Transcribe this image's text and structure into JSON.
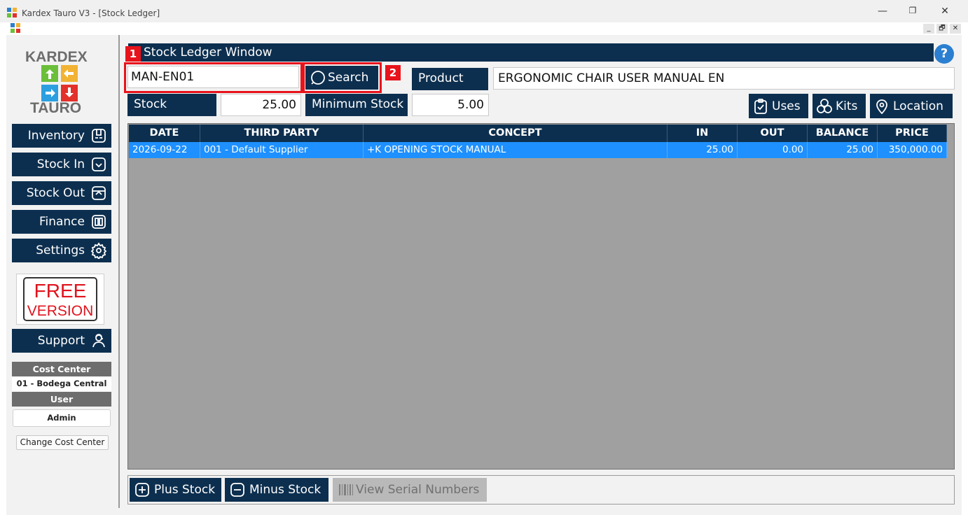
{
  "window": {
    "title": "Kardex Tauro V3 - [Stock Ledger]",
    "controls": {
      "minimize": "—",
      "restore": "❐",
      "close": "✕"
    },
    "mdi_controls": {
      "minimize": "_",
      "restore": "🗗",
      "close": "✕"
    }
  },
  "logo": {
    "top": "KARDEX",
    "bottom": "TAURO"
  },
  "sidebar": {
    "items": [
      {
        "label": "Inventory",
        "icon": "inventory-icon"
      },
      {
        "label": "Stock In",
        "icon": "stock-in-icon"
      },
      {
        "label": "Stock Out",
        "icon": "stock-out-icon"
      },
      {
        "label": "Finance",
        "icon": "book-icon"
      },
      {
        "label": "Settings",
        "icon": "gear-icon"
      }
    ],
    "free_badge": {
      "line1": "FREE",
      "line2": "VERSION"
    },
    "support": {
      "label": "Support",
      "icon": "support-agent-icon"
    },
    "cost_center_label": "Cost Center",
    "cost_center_value": "01 - Bodega Central",
    "user_label": "User",
    "user_value": "Admin",
    "change_cost_center": "Change Cost Center"
  },
  "main": {
    "header_title": "Stock Ledger Window",
    "help": "?",
    "annotations": {
      "one": "1",
      "two": "2"
    },
    "product_code": "MAN-EN01",
    "search_label": "Search",
    "product_label": "Product",
    "product_value": "ERGONOMIC CHAIR USER MANUAL EN",
    "stock_label": "Stock",
    "stock_value": "25.00",
    "min_stock_label": "Minimum Stock",
    "min_stock_value": "5.00",
    "actions": {
      "uses": "Uses",
      "kits": "Kits",
      "location": "Location"
    }
  },
  "table": {
    "columns": [
      "DATE",
      "THIRD PARTY",
      "CONCEPT",
      "IN",
      "OUT",
      "BALANCE",
      "PRICE"
    ],
    "rows": [
      [
        "2026-09-22",
        "001 - Default Supplier",
        "+K OPENING STOCK MANUAL",
        "25.00",
        "0.00",
        "25.00",
        "350,000.00"
      ]
    ]
  },
  "footer": {
    "plus_stock": "Plus Stock",
    "minus_stock": "Minus Stock",
    "view_serials": "View Serial Numbers"
  },
  "colors": {
    "navy": "#0d2f4f",
    "selection": "#1e90ff",
    "highlight_red": "#e8131b",
    "grid_bg": "#a0a0a0"
  }
}
